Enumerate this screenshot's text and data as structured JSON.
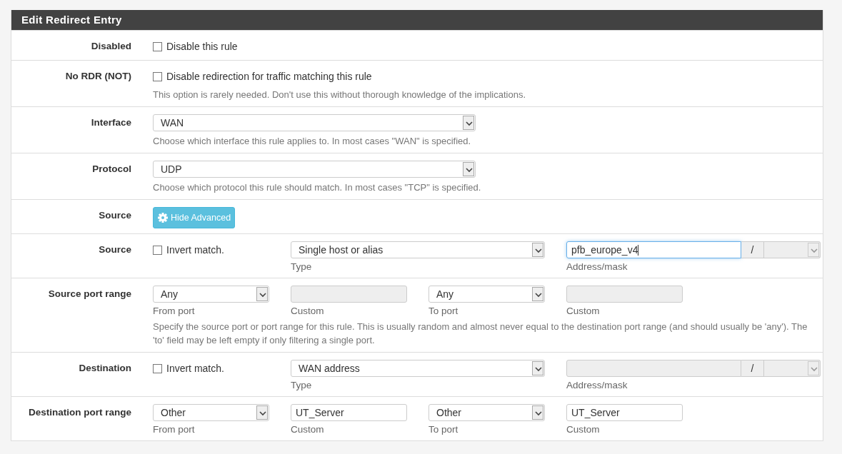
{
  "panel": {
    "title": "Edit Redirect Entry"
  },
  "rows": [
    {
      "kind": "checkbox",
      "label": "Disabled",
      "checkbox": {
        "label": "Disable this rule",
        "checked": false
      }
    },
    {
      "kind": "checkbox",
      "label": "No RDR (NOT)",
      "checkbox": {
        "label": "Disable redirection for traffic matching this rule",
        "checked": false
      },
      "help": "This option is rarely needed. Don't use this without thorough knowledge of the implications."
    },
    {
      "kind": "select",
      "label": "Interface",
      "value": "WAN",
      "help": "Choose which interface this rule applies to. In most cases \"WAN\" is specified."
    },
    {
      "kind": "select",
      "label": "Protocol",
      "value": "UDP",
      "help": "Choose which protocol this rule should match. In most cases \"TCP\" is specified."
    },
    {
      "kind": "button",
      "label": "Source",
      "button": "Hide Advanced"
    },
    {
      "kind": "address",
      "label": "Source",
      "invert": {
        "label": "Invert match.",
        "checked": false
      },
      "type": {
        "value": "Single host or alias",
        "caption": "Type"
      },
      "address": {
        "value": "pfb_europe_v4",
        "disabled": false,
        "focused": true,
        "caption": "Address/mask"
      },
      "slash": "/",
      "mask": {
        "disabled": true
      }
    },
    {
      "kind": "ports",
      "label": "Source port range",
      "fields": [
        {
          "kind": "select",
          "value": "Any",
          "caption": "From port"
        },
        {
          "kind": "input",
          "disabled": true,
          "caption": "Custom"
        },
        {
          "kind": "select",
          "value": "Any",
          "caption": "To port"
        },
        {
          "kind": "input",
          "disabled": true,
          "caption": "Custom"
        }
      ],
      "help": "Specify the source port or port range for this rule. This is usually random and almost never equal to the destination port range (and should usually be 'any'). The 'to' field may be left empty if only filtering a single port."
    },
    {
      "kind": "address",
      "label": "Destination",
      "invert": {
        "label": "Invert match.",
        "checked": false
      },
      "type": {
        "value": "WAN address",
        "caption": "Type"
      },
      "address": {
        "disabled": true,
        "focused": false,
        "caption": "Address/mask"
      },
      "slash": "/",
      "mask": {
        "disabled": true
      }
    },
    {
      "kind": "ports",
      "label": "Destination port range",
      "fields": [
        {
          "kind": "select",
          "value": "Other",
          "caption": "From port"
        },
        {
          "kind": "input",
          "value": "UT_Server",
          "disabled": false,
          "caption": "Custom"
        },
        {
          "kind": "select",
          "value": "Other",
          "caption": "To port"
        },
        {
          "kind": "input",
          "value": "UT_Server",
          "disabled": false,
          "caption": "Custom"
        }
      ]
    }
  ]
}
